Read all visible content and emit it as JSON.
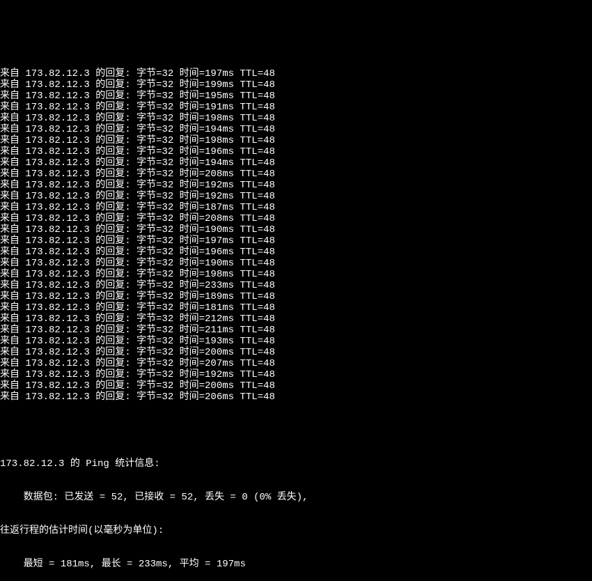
{
  "ping": {
    "ip": "173.82.12.3",
    "reply_prefix": "来自 ",
    "reply_suffix": " 的回复: ",
    "bytes_label": "字节=",
    "bytes": 32,
    "time_label": "时间=",
    "time_unit": "ms",
    "ttl_label": "TTL=",
    "ttl": 48,
    "replies": [
      197,
      199,
      195,
      191,
      198,
      194,
      198,
      196,
      194,
      208,
      192,
      192,
      187,
      208,
      190,
      197,
      196,
      190,
      198,
      233,
      189,
      181,
      212,
      211,
      193,
      200,
      207,
      192,
      200,
      206
    ],
    "stats": {
      "header_line": "173.82.12.3 的 Ping 统计信息:",
      "packets_line": "    数据包: 已发送 = 52, 已接收 = 52, 丢失 = 0 (0% 丢失),",
      "rtt_header_line": "往返行程的估计时间(以毫秒为单位):",
      "rtt_line": "    最短 = 181ms, 最长 = 233ms, 平均 = 197ms"
    }
  }
}
